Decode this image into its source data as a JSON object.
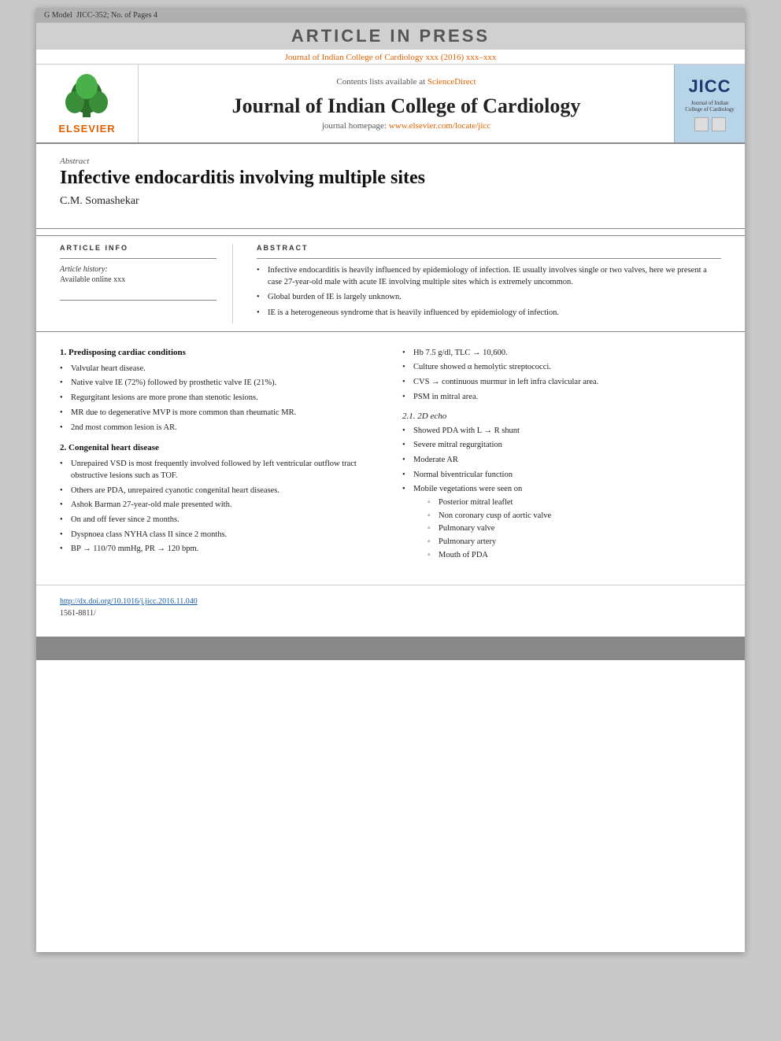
{
  "topBar": {
    "gModel": "G Model",
    "jicc": "JICC-352; No. of Pages 4"
  },
  "banner": {
    "text": "ARTICLE IN PRESS"
  },
  "journalRef": {
    "text": "Journal of Indian College of Cardiology xxx (2016) xxx–xxx"
  },
  "header": {
    "contentsLine": "Contents lists available at",
    "sciencedirectLabel": "ScienceDirect",
    "journalName": "Journal of Indian College of Cardiology",
    "homepageLabel": "journal homepage:",
    "homepageUrl": "www.elsevier.com/locate/jicc",
    "elsevierText": "ELSEVIER",
    "jiccBadge": "JICC"
  },
  "abstract": {
    "label": "Abstract",
    "title": "Infective endocarditis involving multiple sites",
    "author": "C.M. Somashekar"
  },
  "articleInfo": {
    "heading": "Article Info",
    "historyLabel": "Article history:",
    "historyValue": "Available online xxx"
  },
  "abstractSection": {
    "heading": "Abstract",
    "bullets": [
      "Infective endocarditis is heavily influenced by epidemiology of infection. IE usually involves single or two valves, here we present a case 27-year-old male with acute IE involving multiple sites which is extremely uncommon.",
      "Global burden of IE is largely unknown.",
      "IE is a heterogeneous syndrome that is heavily influenced by epidemiology of infection."
    ]
  },
  "sections": {
    "left": {
      "section1": {
        "heading": "1. Predisposing cardiac conditions",
        "bullets": [
          "Valvular heart disease.",
          "Native valve IE (72%) followed by prosthetic valve IE (21%).",
          "Regurgitant lesions are more prone than stenotic lesions.",
          "MR due to degenerative MVP is more common than rheumatic MR.",
          "2nd most common lesion is AR."
        ]
      },
      "section2": {
        "heading": "2. Congenital heart disease",
        "bullets": [
          "Unrepaired VSD is most frequently involved followed by left ventricular outflow tract obstructive lesions such as TOF.",
          "Others are PDA, unrepaired cyanotic congenital heart diseases.",
          "Ashok Barman 27-year-old male presented with.",
          "On and off fever since 2 months.",
          "Dyspnoea class NYHA class II since 2 months.",
          "BP → 110/70 mmHg, PR → 120 bpm."
        ]
      }
    },
    "right": {
      "bullets1": [
        "Hb 7.5 g/dl, TLC → 10,600.",
        "Culture showed α hemolytic streptococci.",
        "CVS → continuous murmur in left infra clavicular area.",
        "PSM in mitral area."
      ],
      "subsectionHeading": "2.1. 2D echo",
      "bullets2": [
        "Showed PDA with L → R shunt",
        "Severe mitral regurgitation",
        "Moderate AR",
        "Normal biventricular function",
        "Mobile vegetations were seen on"
      ],
      "subBullets": [
        "Posterior mitral leaflet",
        "Non coronary cusp of aortic valve",
        "Pulmonary valve",
        "Pulmonary artery",
        "Mouth of PDA"
      ]
    }
  },
  "footer": {
    "doi": "http://dx.doi.org/10.1016/j.jicc.2016.11.040",
    "issn": "1561-8811/"
  }
}
